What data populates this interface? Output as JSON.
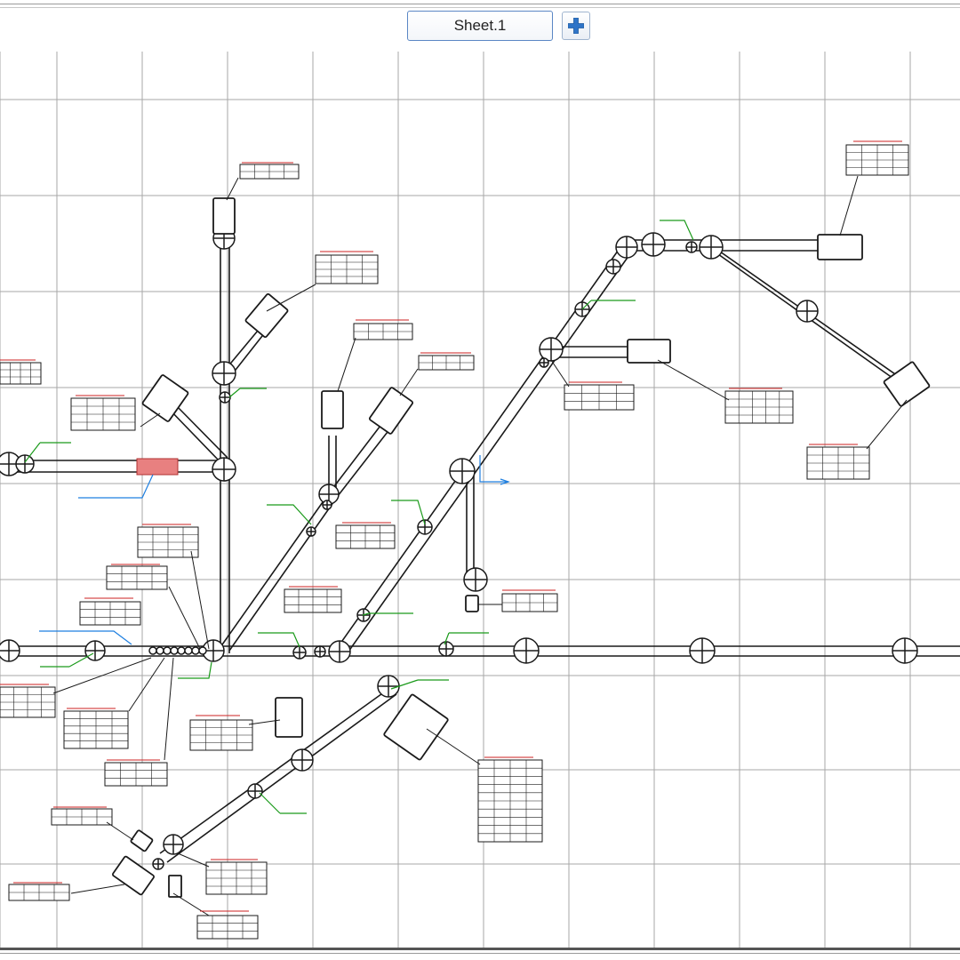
{
  "tabs": {
    "active_sheet": "Sheet.1"
  },
  "icons": {
    "add_sheet": "plus-icon"
  },
  "colors": {
    "accent": "#2f74c7",
    "grid": "#9a9a9a",
    "leader_green": "#1a9a1a",
    "leader_blue": "#1e7fe0",
    "label_red": "#cc2222",
    "highlight": "#e88080"
  }
}
